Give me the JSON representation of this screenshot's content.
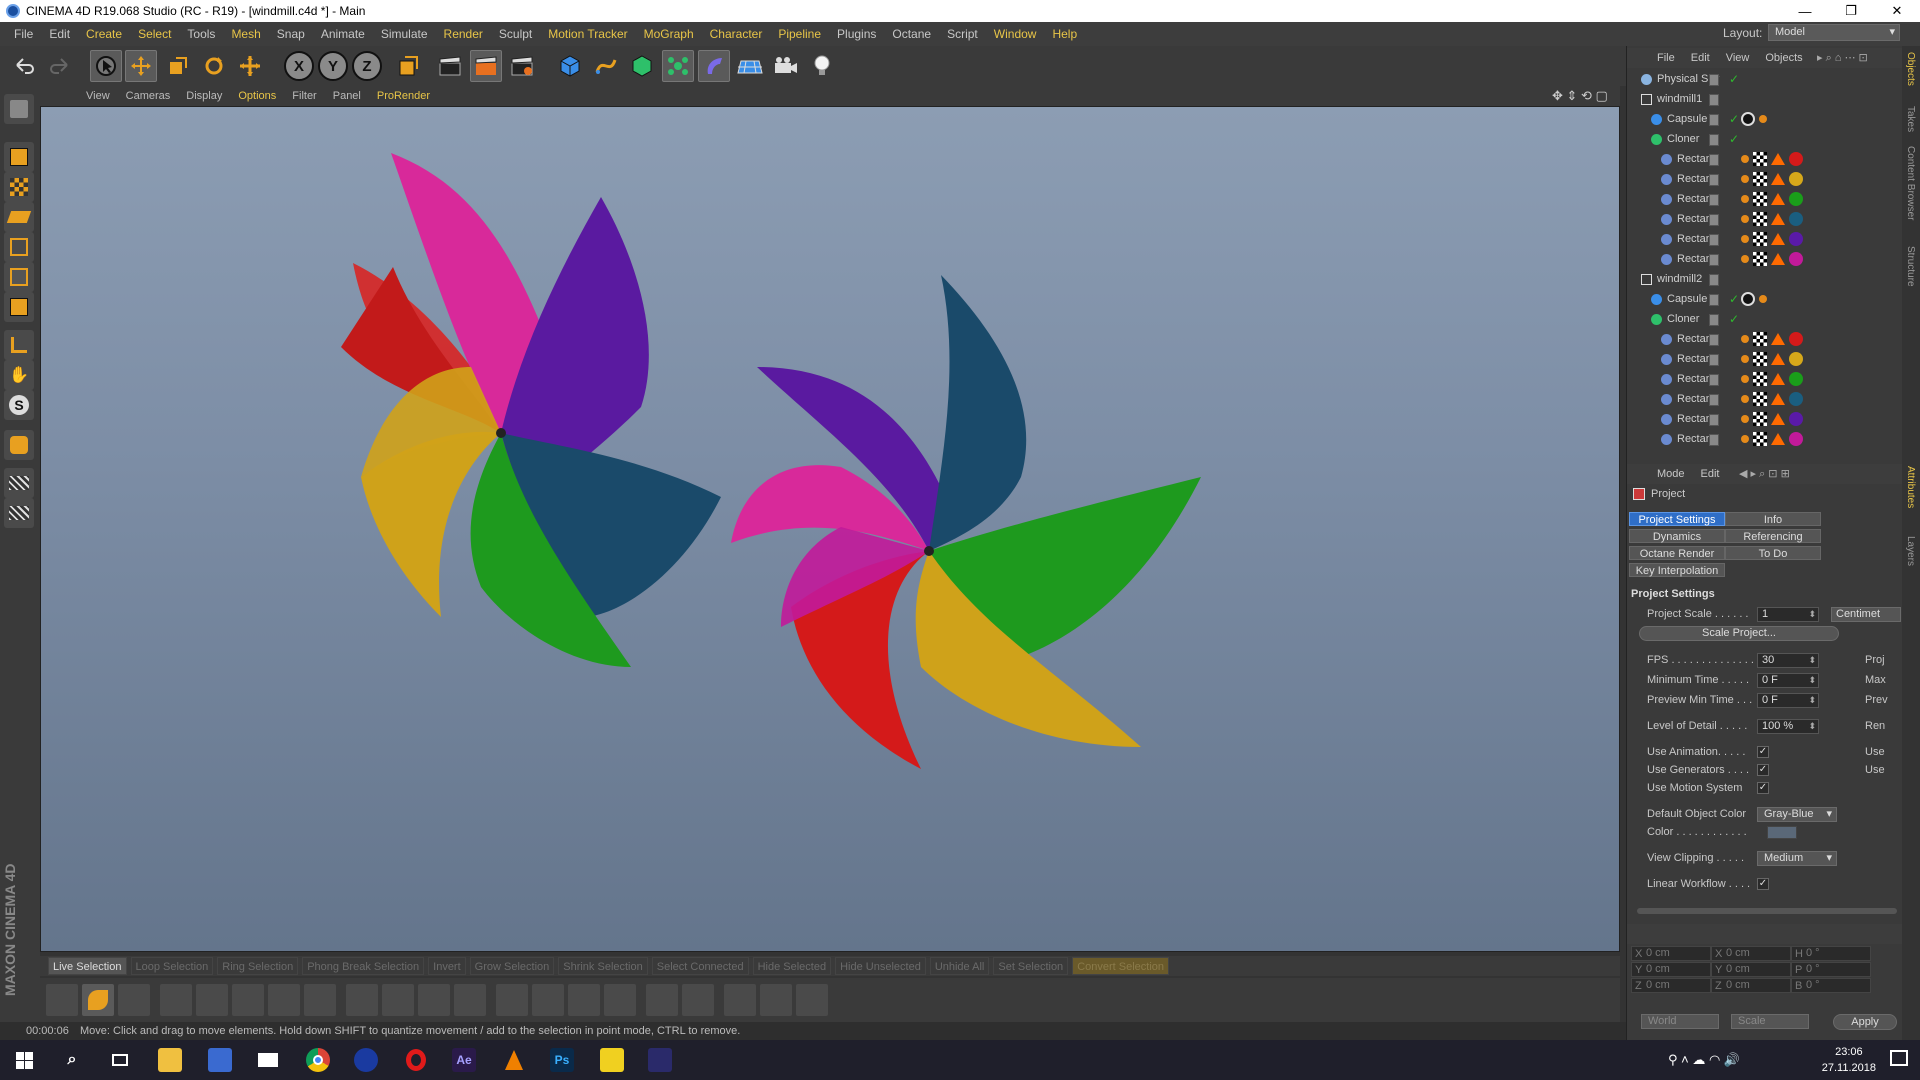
{
  "window": {
    "title": "CINEMA 4D R19.068 Studio (RC - R19) - [windmill.c4d *] - Main",
    "minimize": "—",
    "maximize": "❐",
    "close": "✕"
  },
  "menu": {
    "items": [
      "File",
      "Edit",
      "Create",
      "Select",
      "Tools",
      "Mesh",
      "Snap",
      "Animate",
      "Simulate",
      "Render",
      "Sculpt",
      "Motion Tracker",
      "MoGraph",
      "Character",
      "Pipeline",
      "Plugins",
      "Octane",
      "Script",
      "Window",
      "Help"
    ],
    "layout_label": "Layout:",
    "layout_value": "Model"
  },
  "viewport": {
    "menu": [
      "View",
      "Cameras",
      "Display",
      "Options",
      "Filter",
      "Panel",
      "ProRender"
    ]
  },
  "selection_bar": {
    "items": [
      "Live Selection",
      "Loop Selection",
      "Ring Selection",
      "Phong Break Selection",
      "Invert",
      "Grow Selection",
      "Shrink Selection",
      "Select Connected",
      "Hide Selected",
      "Hide Unselected",
      "Unhide All",
      "Set Selection",
      "Convert Selection"
    ]
  },
  "status": {
    "time": "00:00:06",
    "message": "Move: Click and drag to move elements. Hold down SHIFT to quantize movement / add to the selection in point mode, CTRL to remove."
  },
  "objects_panel": {
    "menu": [
      "File",
      "Edit",
      "View",
      "Objects"
    ],
    "rows": [
      {
        "name": "Physical Sky",
        "indent": 0
      },
      {
        "name": "windmill1",
        "indent": 0
      },
      {
        "name": "Capsule",
        "indent": 1
      },
      {
        "name": "Cloner",
        "indent": 1
      },
      {
        "name": "Rectan",
        "indent": 2,
        "color": "#d41a1a"
      },
      {
        "name": "Rectan",
        "indent": 2,
        "color": "#d6a81a"
      },
      {
        "name": "Rectan",
        "indent": 2,
        "color": "#1a9e1a"
      },
      {
        "name": "Rectan",
        "indent": 2,
        "color": "#1a5e80"
      },
      {
        "name": "Rectan",
        "indent": 2,
        "color": "#5a1aa8"
      },
      {
        "name": "Rectan",
        "indent": 2,
        "color": "#c21a9a"
      },
      {
        "name": "windmill2",
        "indent": 0
      },
      {
        "name": "Capsule",
        "indent": 1
      },
      {
        "name": "Cloner",
        "indent": 1
      },
      {
        "name": "Rectan",
        "indent": 2,
        "color": "#d41a1a"
      },
      {
        "name": "Rectan",
        "indent": 2,
        "color": "#d6a81a"
      },
      {
        "name": "Rectan",
        "indent": 2,
        "color": "#1a9e1a"
      },
      {
        "name": "Rectan",
        "indent": 2,
        "color": "#1a5e80"
      },
      {
        "name": "Rectan",
        "indent": 2,
        "color": "#5a1aa8"
      },
      {
        "name": "Rectan",
        "indent": 2,
        "color": "#c21a9a"
      }
    ]
  },
  "attributes_panel": {
    "menu": [
      "Mode",
      "Edit"
    ],
    "header": "Project",
    "tabs": [
      "Project Settings",
      "Info",
      "Dynamics",
      "Referencing",
      "Octane Render",
      "To Do",
      "Key Interpolation"
    ],
    "section": "Project Settings",
    "project_scale_label": "Project Scale . . . . . .",
    "project_scale_value": "1",
    "project_scale_unit": "Centimet",
    "scale_project_button": "Scale Project...",
    "fps_label": "FPS . . . . . . . . . . . . . .",
    "fps_value": "30",
    "fps_right": "Proj",
    "min_time_label": "Minimum Time . . . . .",
    "min_time_value": "0 F",
    "min_time_right": "Max",
    "preview_min_label": "Preview Min Time . . .",
    "preview_min_value": "0 F",
    "preview_min_right": "Prev",
    "lod_label": "Level of Detail . . . . .",
    "lod_value": "100 %",
    "lod_right": "Ren",
    "use_animation_label": "Use Animation. . . . .",
    "use_animation_right": "Use",
    "use_generators_label": "Use Generators . . . .",
    "use_generators_right": "Use",
    "use_motion_label": "Use Motion System",
    "default_color_label": "Default Object Color",
    "default_color_value": "Gray-Blue",
    "color_label": "Color . . . . . . . . . . . .",
    "view_clipping_label": "View Clipping . . . . .",
    "view_clipping_value": "Medium",
    "linear_workflow_label": "Linear Workflow . . . .",
    "check": "✓"
  },
  "coords_panel": {
    "rows": [
      {
        "a": "X",
        "av": "0 cm",
        "b": "X",
        "bv": "0 cm",
        "c": "H",
        "cv": "0 °"
      },
      {
        "a": "Y",
        "av": "0 cm",
        "b": "Y",
        "bv": "0 cm",
        "c": "P",
        "cv": "0 °"
      },
      {
        "a": "Z",
        "av": "0 cm",
        "b": "Z",
        "bv": "0 cm",
        "c": "B",
        "cv": "0 °"
      }
    ],
    "world": "World",
    "scale": "Scale",
    "apply": "Apply"
  },
  "side_tabs": [
    "Objects",
    "Takes",
    "Content Browser",
    "Structure",
    "Attributes",
    "Layers"
  ],
  "taskbar": {
    "time": "23:06",
    "date": "27.11.2018"
  },
  "colors": {
    "red": "#d41a1a",
    "yellow": "#d6a81a",
    "green": "#2ea81a",
    "teal": "#1a5e7a",
    "purple": "#5a1aa8",
    "magenta": "#c21a9a",
    "accent": "#e8c548",
    "selected_tab": "#2f6ec7"
  }
}
